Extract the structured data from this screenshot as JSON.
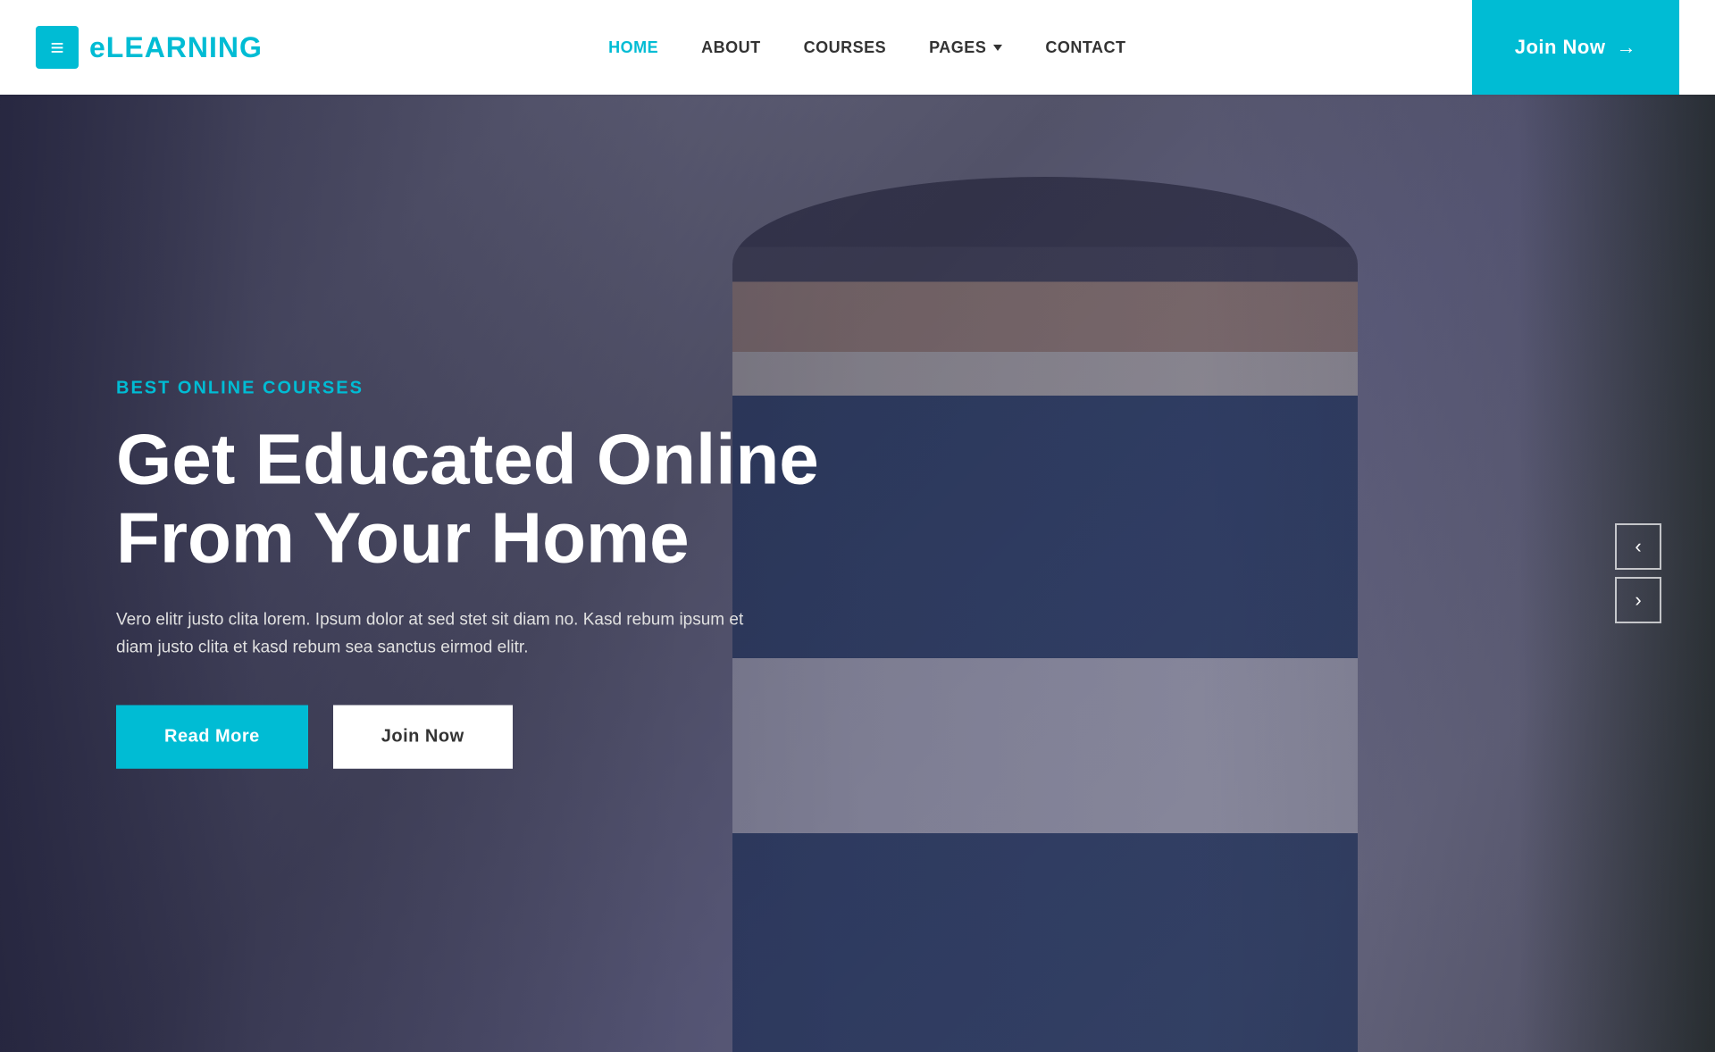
{
  "brand": {
    "icon": "≡",
    "name": "eLEARNING"
  },
  "navbar": {
    "links": [
      {
        "label": "HOME",
        "active": true,
        "id": "home"
      },
      {
        "label": "ABOUT",
        "active": false,
        "id": "about"
      },
      {
        "label": "COURSES",
        "active": false,
        "id": "courses"
      },
      {
        "label": "PAGES",
        "active": false,
        "id": "pages",
        "has_dropdown": true
      },
      {
        "label": "CONTACT",
        "active": false,
        "id": "contact"
      }
    ],
    "join_label": "Join Now",
    "join_arrow": "→"
  },
  "hero": {
    "subtitle": "BEST ONLINE COURSES",
    "title_line1": "Get Educated Online",
    "title_line2": "From Your Home",
    "description": "Vero elitr justo clita lorem. Ipsum dolor at sed stet sit diam no. Kasd rebum ipsum et diam justo clita et kasd rebum sea sanctus eirmod elitr.",
    "btn_read_more": "Read More",
    "btn_join_now": "Join Now",
    "slider_prev": "‹",
    "slider_next": "›"
  },
  "colors": {
    "accent": "#00bcd4",
    "white": "#ffffff",
    "dark": "#333333"
  }
}
